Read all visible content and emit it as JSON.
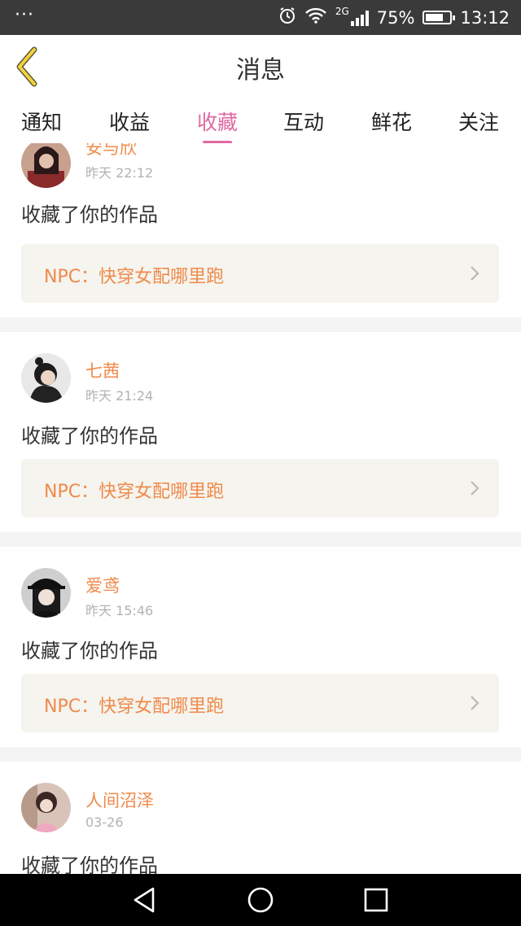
{
  "status": {
    "dots": "···",
    "network": "2G",
    "battery_percent": "75%",
    "battery_level": 0.75,
    "time": "13:12",
    "icons": [
      "alarm-icon",
      "wifi-icon",
      "signal-icon",
      "battery-icon"
    ]
  },
  "header": {
    "title": "消息",
    "back_icon": "chevron-left-icon"
  },
  "tabs": [
    {
      "label": "通知"
    },
    {
      "label": "收益"
    },
    {
      "label": "收藏",
      "active": true
    },
    {
      "label": "互动"
    },
    {
      "label": "鲜花"
    },
    {
      "label": "关注"
    }
  ],
  "items": [
    {
      "name": "安与欣",
      "time": "昨天 22:12",
      "action": "收藏了你的作品",
      "work": "NPC：快穿女配哪里跑"
    },
    {
      "name": "七茜",
      "time": "昨天 21:24",
      "action": "收藏了你的作品",
      "work": "NPC：快穿女配哪里跑"
    },
    {
      "name": "爱鸢",
      "time": "昨天 15:46",
      "action": "收藏了你的作品",
      "work": "NPC：快穿女配哪里跑"
    },
    {
      "name": "人间沼泽",
      "time": "03-26",
      "action": "收藏了你的作品",
      "work": ""
    }
  ],
  "colors": {
    "accent": "#e069a0",
    "username": "#f08a4b",
    "card_bg": "#f5f4ee"
  },
  "navbar": {
    "icons": [
      "back-triangle-icon",
      "home-circle-icon",
      "recents-square-icon"
    ]
  }
}
